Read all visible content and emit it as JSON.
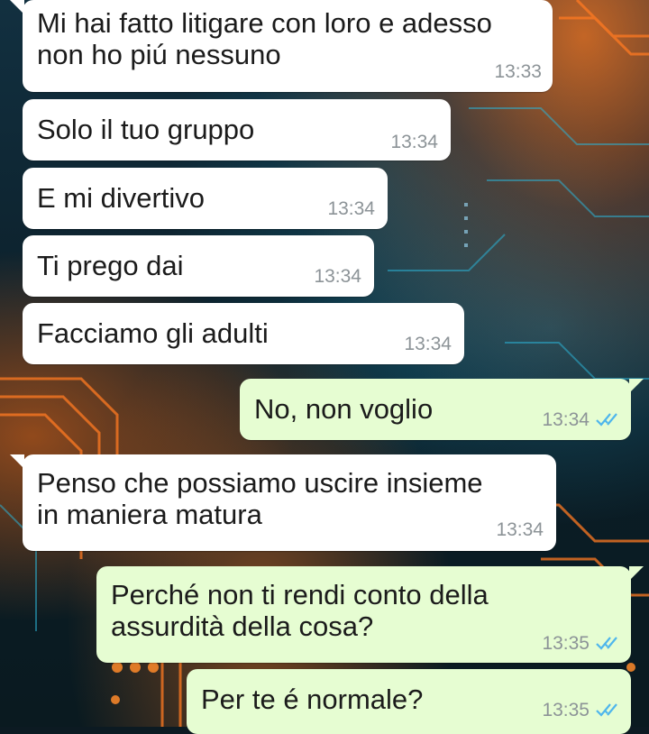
{
  "messages": [
    {
      "direction": "incoming",
      "text": "Mi hai fatto litigare con loro e adesso\nnon ho piú nessuno",
      "time": "13:33"
    },
    {
      "direction": "incoming",
      "text": "Solo il tuo gruppo",
      "time": "13:34"
    },
    {
      "direction": "incoming",
      "text": "E mi divertivo",
      "time": "13:34"
    },
    {
      "direction": "incoming",
      "text": "Ti prego dai",
      "time": "13:34"
    },
    {
      "direction": "incoming",
      "text": "Facciamo gli adulti",
      "time": "13:34"
    },
    {
      "direction": "outgoing",
      "text": "No, non voglio",
      "time": "13:34",
      "status": "read"
    },
    {
      "direction": "incoming",
      "text": "Penso che possiamo uscire insieme\nin maniera matura",
      "time": "13:34"
    },
    {
      "direction": "outgoing",
      "text": "Perché non ti rendi conto della\nassurdità della cosa?",
      "time": "13:35",
      "status": "read"
    },
    {
      "direction": "outgoing",
      "text": "Per te é normale?",
      "time": "13:35",
      "status": "read"
    }
  ],
  "colors": {
    "incoming_bubble": "#ffffff",
    "outgoing_bubble": "#e6fdd2",
    "read_ticks": "#4fb6ec",
    "timestamp": "#8c9397"
  },
  "icons": {
    "read_status": "double-check-icon"
  },
  "wallpaper": "circuit-board-orange-teal"
}
